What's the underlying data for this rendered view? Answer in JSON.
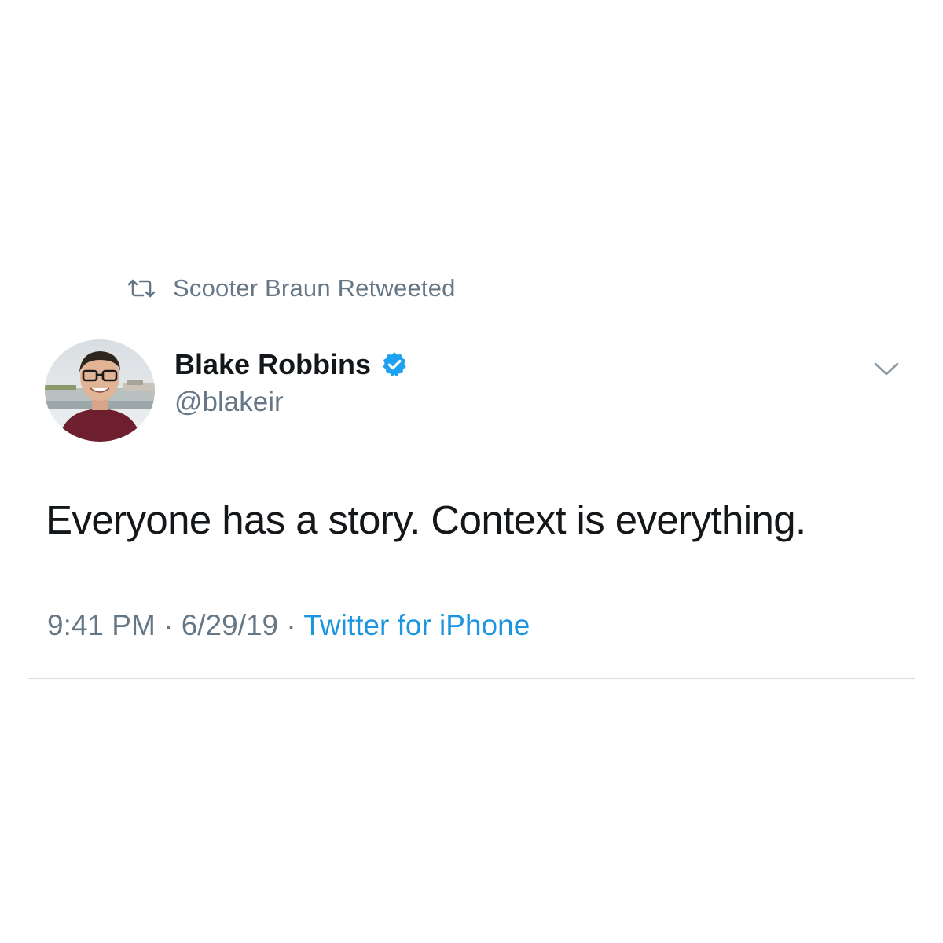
{
  "retweet": {
    "icon": "retweet-icon",
    "text": "Scooter Braun Retweeted"
  },
  "author": {
    "display_name": "Blake Robbins",
    "handle": "@blakeir",
    "verified": true,
    "verified_icon": "verified-badge-icon",
    "avatar_icon": "avatar-photo"
  },
  "tweet": {
    "text": "Everyone has a story. Context is everything."
  },
  "meta": {
    "time": "9:41 PM",
    "separator": " · ",
    "date": "6/29/19",
    "source": "Twitter for iPhone"
  },
  "menu": {
    "icon": "chevron-down-icon"
  },
  "colors": {
    "text_primary": "#14171a",
    "text_secondary": "#657786",
    "link_blue": "#1b95e0",
    "verified_blue": "#1da1f2",
    "divider": "#d8dde1"
  }
}
